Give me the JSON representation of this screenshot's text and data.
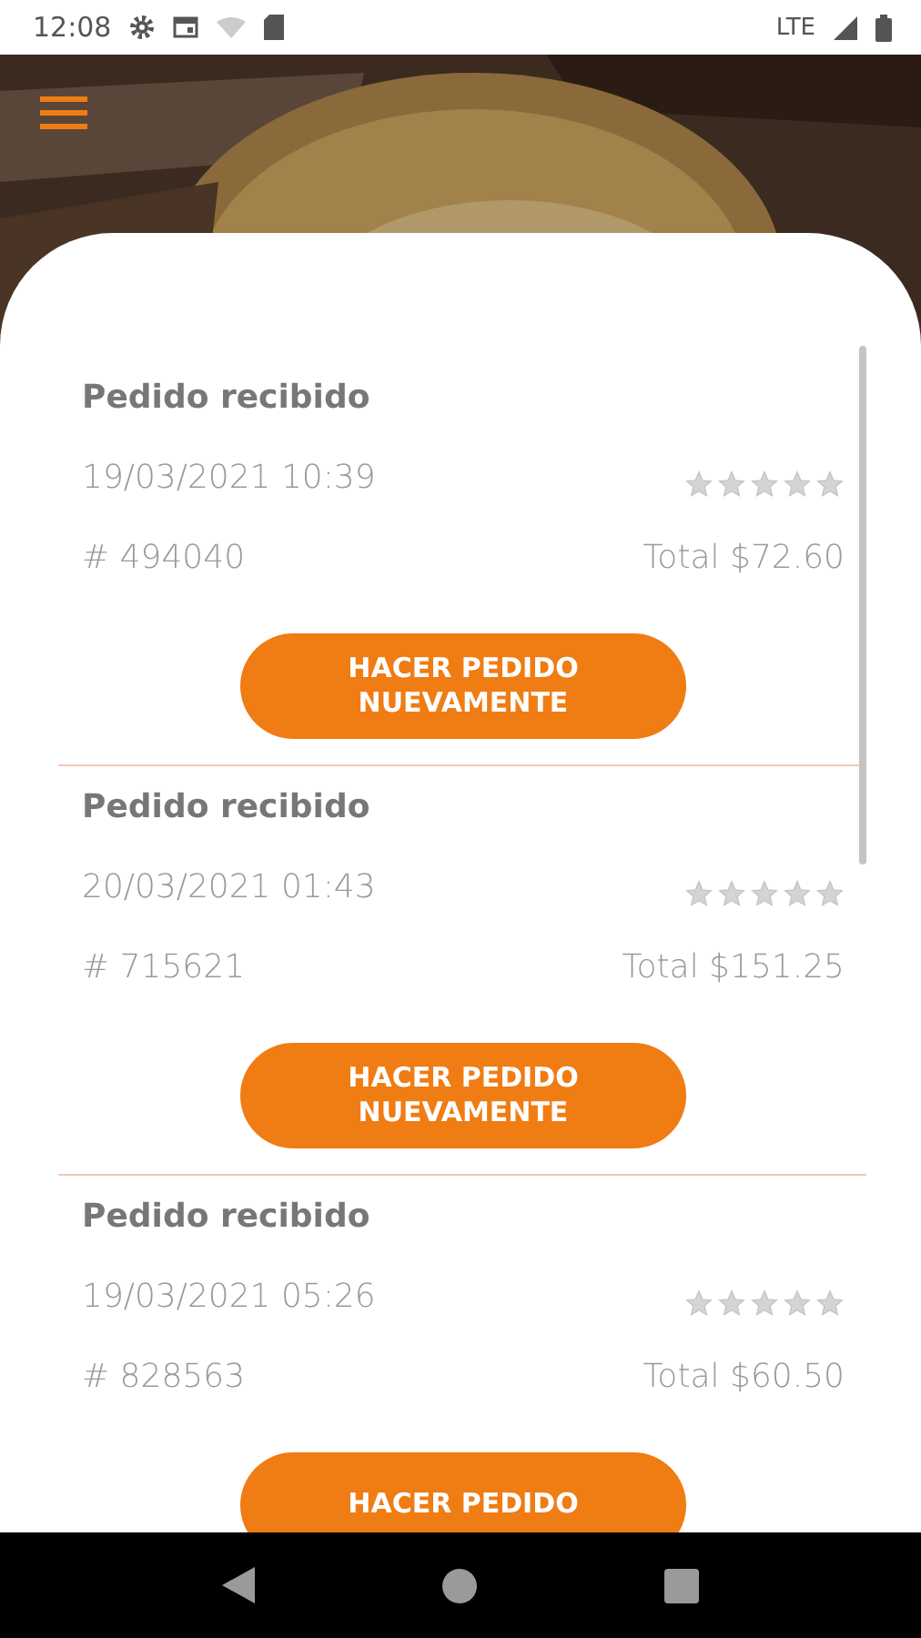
{
  "status_bar": {
    "time": "12:08",
    "network": "LTE"
  },
  "orders": [
    {
      "status": "Pedido recibido",
      "date": "19/03/2021 10:39",
      "stars": 0,
      "number": "# 494040",
      "total": "Total $72.60",
      "button": "HACER PEDIDO NUEVAMENTE"
    },
    {
      "status": "Pedido recibido",
      "date": "20/03/2021 01:43",
      "stars": 0,
      "number": "# 715621",
      "total": "Total $151.25",
      "button": "HACER PEDIDO NUEVAMENTE"
    },
    {
      "status": "Pedido recibido",
      "date": "19/03/2021 05:26",
      "stars": 0,
      "number": "# 828563",
      "total": "Total $60.50",
      "button": "HACER PEDIDO"
    }
  ]
}
